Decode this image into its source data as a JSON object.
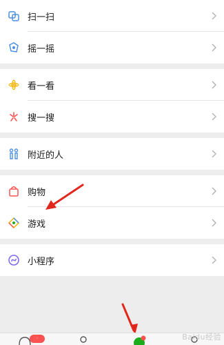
{
  "menu": {
    "scan_label": "扫一扫",
    "shake_label": "摇一摇",
    "look_label": "看一看",
    "search_label": "搜一搜",
    "nearby_label": "附近的人",
    "shop_label": "购物",
    "games_label": "游戏",
    "miniprograms_label": "小程序"
  },
  "icons": {
    "scan": "scan-icon",
    "shake": "shake-icon",
    "look": "look-icon",
    "search": "search-icon",
    "nearby": "people-icon",
    "shop": "shopping-bag-icon",
    "games": "game-icon",
    "miniprograms": "mini-program-icon",
    "chevron": "chevron-right-icon"
  },
  "tabbar": {
    "chats_badge": "·",
    "watermark": "Baidu经验"
  },
  "colors": {
    "accent_blue": "#4a90e2",
    "annotation_red": "#e0271c",
    "discover_green": "#1aad19"
  }
}
